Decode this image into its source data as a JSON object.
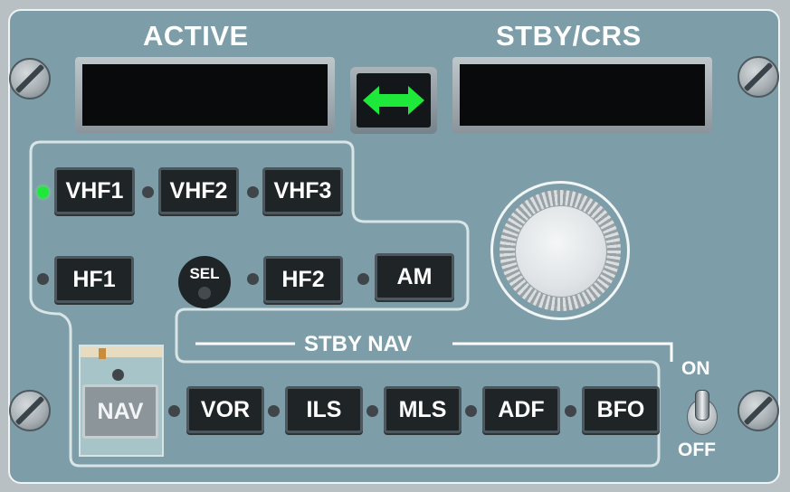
{
  "headers": {
    "active": "ACTIVE",
    "standby": "STBY/CRS"
  },
  "transfer": {
    "icon": "double-arrow-icon",
    "color": "#1ee83a"
  },
  "radios": {
    "vhf1": "VHF1",
    "vhf2": "VHF2",
    "vhf3": "VHF3",
    "hf1": "HF1",
    "hf2": "HF2",
    "am": "AM",
    "sel": "SEL"
  },
  "stby_nav": {
    "title": "STBY NAV",
    "nav": "NAV",
    "buttons": [
      "VOR",
      "ILS",
      "MLS",
      "ADF",
      "BFO"
    ]
  },
  "toggle": {
    "on": "ON",
    "off": "OFF"
  },
  "indicators": {
    "active_led": "vhf1",
    "led_on_color": "#1ee83a"
  },
  "colors": {
    "panel": "#7d9ea8",
    "button": "#1f2427",
    "display": "#080a0b"
  }
}
